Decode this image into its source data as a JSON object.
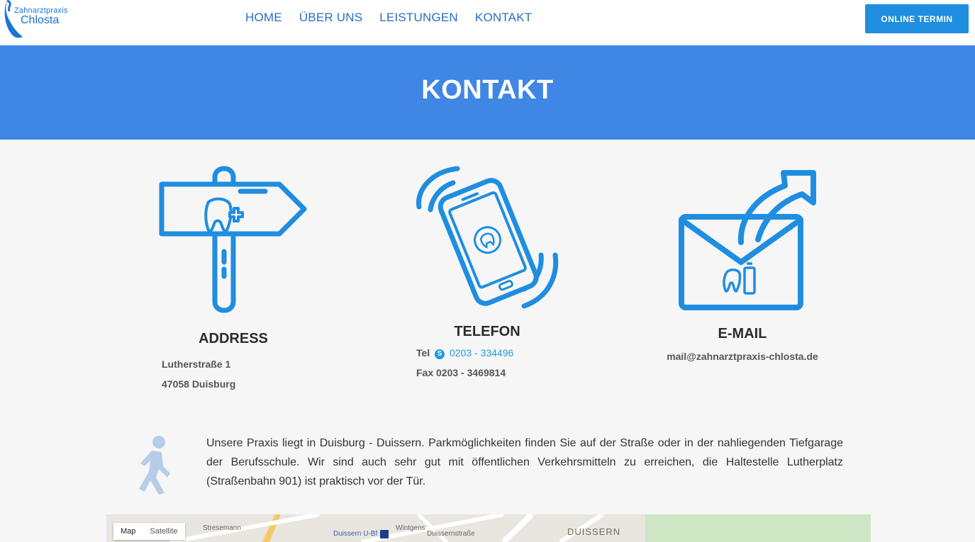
{
  "header": {
    "logo_line1": "Zahnarztpraxis",
    "logo_line2": "Chlosta",
    "nav": [
      "HOME",
      "ÜBER UNS",
      "LEISTUNGEN",
      "KONTAKT"
    ],
    "cta_label": "ONLINE TERMIN"
  },
  "banner": {
    "title": "KONTAKT"
  },
  "address": {
    "title": "ADDRESS",
    "line1": "Lutherstraße 1",
    "line2": "47058 Duisburg"
  },
  "phone": {
    "title": "TELEFON",
    "tel_label": "Tel",
    "tel_number": "0203 - 334496",
    "fax": "Fax 0203 - 3469814"
  },
  "email": {
    "title": "E-MAIL",
    "address": "mail@zahnarztpraxis-chlosta.de"
  },
  "directions": {
    "text": "Unsere Praxis liegt in Duisburg - Duissern. Parkmöglichkeiten finden Sie auf der Straße oder in der nahliegenden Tiefgarage der Berufsschule. Wir sind auch sehr gut mit öffentlichen Verkehrsmitteln zu erreichen, die Haltestelle Lutherplatz (Straßenbahn 901) ist praktisch vor der Tür."
  },
  "map": {
    "tab_map": "Map",
    "tab_satellite": "Satellite",
    "labels": [
      "Duissern U-Bf",
      "DUISSERN",
      "Wintgens",
      "Stresemann",
      "Duissernstraße"
    ]
  },
  "colors": {
    "primary": "#1f8ee0",
    "banner": "#3f86e5",
    "nav": "#2c6cbf"
  }
}
